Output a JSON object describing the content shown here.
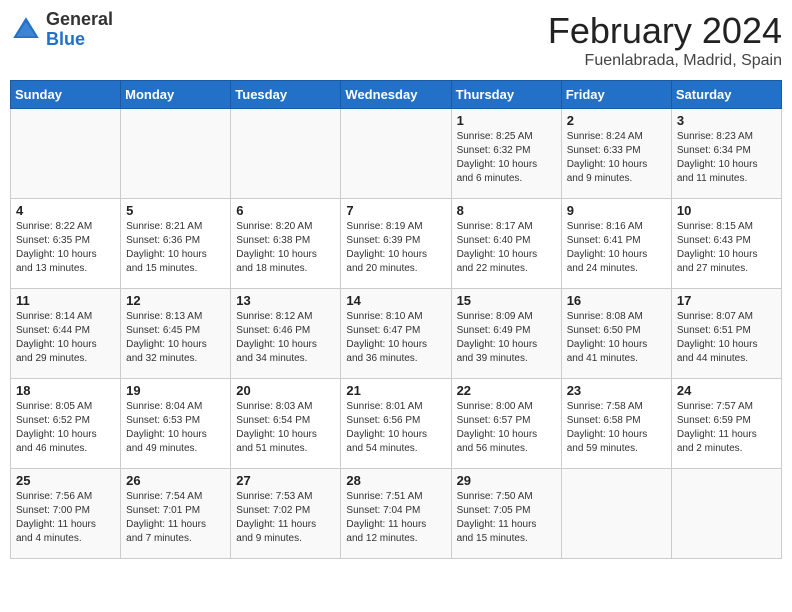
{
  "header": {
    "logo_general": "General",
    "logo_blue": "Blue",
    "title": "February 2024",
    "subtitle": "Fuenlabrada, Madrid, Spain"
  },
  "days_of_week": [
    "Sunday",
    "Monday",
    "Tuesday",
    "Wednesday",
    "Thursday",
    "Friday",
    "Saturday"
  ],
  "weeks": [
    [
      {
        "day": "",
        "info": ""
      },
      {
        "day": "",
        "info": ""
      },
      {
        "day": "",
        "info": ""
      },
      {
        "day": "",
        "info": ""
      },
      {
        "day": "1",
        "info": "Sunrise: 8:25 AM\nSunset: 6:32 PM\nDaylight: 10 hours\nand 6 minutes."
      },
      {
        "day": "2",
        "info": "Sunrise: 8:24 AM\nSunset: 6:33 PM\nDaylight: 10 hours\nand 9 minutes."
      },
      {
        "day": "3",
        "info": "Sunrise: 8:23 AM\nSunset: 6:34 PM\nDaylight: 10 hours\nand 11 minutes."
      }
    ],
    [
      {
        "day": "4",
        "info": "Sunrise: 8:22 AM\nSunset: 6:35 PM\nDaylight: 10 hours\nand 13 minutes."
      },
      {
        "day": "5",
        "info": "Sunrise: 8:21 AM\nSunset: 6:36 PM\nDaylight: 10 hours\nand 15 minutes."
      },
      {
        "day": "6",
        "info": "Sunrise: 8:20 AM\nSunset: 6:38 PM\nDaylight: 10 hours\nand 18 minutes."
      },
      {
        "day": "7",
        "info": "Sunrise: 8:19 AM\nSunset: 6:39 PM\nDaylight: 10 hours\nand 20 minutes."
      },
      {
        "day": "8",
        "info": "Sunrise: 8:17 AM\nSunset: 6:40 PM\nDaylight: 10 hours\nand 22 minutes."
      },
      {
        "day": "9",
        "info": "Sunrise: 8:16 AM\nSunset: 6:41 PM\nDaylight: 10 hours\nand 24 minutes."
      },
      {
        "day": "10",
        "info": "Sunrise: 8:15 AM\nSunset: 6:43 PM\nDaylight: 10 hours\nand 27 minutes."
      }
    ],
    [
      {
        "day": "11",
        "info": "Sunrise: 8:14 AM\nSunset: 6:44 PM\nDaylight: 10 hours\nand 29 minutes."
      },
      {
        "day": "12",
        "info": "Sunrise: 8:13 AM\nSunset: 6:45 PM\nDaylight: 10 hours\nand 32 minutes."
      },
      {
        "day": "13",
        "info": "Sunrise: 8:12 AM\nSunset: 6:46 PM\nDaylight: 10 hours\nand 34 minutes."
      },
      {
        "day": "14",
        "info": "Sunrise: 8:10 AM\nSunset: 6:47 PM\nDaylight: 10 hours\nand 36 minutes."
      },
      {
        "day": "15",
        "info": "Sunrise: 8:09 AM\nSunset: 6:49 PM\nDaylight: 10 hours\nand 39 minutes."
      },
      {
        "day": "16",
        "info": "Sunrise: 8:08 AM\nSunset: 6:50 PM\nDaylight: 10 hours\nand 41 minutes."
      },
      {
        "day": "17",
        "info": "Sunrise: 8:07 AM\nSunset: 6:51 PM\nDaylight: 10 hours\nand 44 minutes."
      }
    ],
    [
      {
        "day": "18",
        "info": "Sunrise: 8:05 AM\nSunset: 6:52 PM\nDaylight: 10 hours\nand 46 minutes."
      },
      {
        "day": "19",
        "info": "Sunrise: 8:04 AM\nSunset: 6:53 PM\nDaylight: 10 hours\nand 49 minutes."
      },
      {
        "day": "20",
        "info": "Sunrise: 8:03 AM\nSunset: 6:54 PM\nDaylight: 10 hours\nand 51 minutes."
      },
      {
        "day": "21",
        "info": "Sunrise: 8:01 AM\nSunset: 6:56 PM\nDaylight: 10 hours\nand 54 minutes."
      },
      {
        "day": "22",
        "info": "Sunrise: 8:00 AM\nSunset: 6:57 PM\nDaylight: 10 hours\nand 56 minutes."
      },
      {
        "day": "23",
        "info": "Sunrise: 7:58 AM\nSunset: 6:58 PM\nDaylight: 10 hours\nand 59 minutes."
      },
      {
        "day": "24",
        "info": "Sunrise: 7:57 AM\nSunset: 6:59 PM\nDaylight: 11 hours\nand 2 minutes."
      }
    ],
    [
      {
        "day": "25",
        "info": "Sunrise: 7:56 AM\nSunset: 7:00 PM\nDaylight: 11 hours\nand 4 minutes."
      },
      {
        "day": "26",
        "info": "Sunrise: 7:54 AM\nSunset: 7:01 PM\nDaylight: 11 hours\nand 7 minutes."
      },
      {
        "day": "27",
        "info": "Sunrise: 7:53 AM\nSunset: 7:02 PM\nDaylight: 11 hours\nand 9 minutes."
      },
      {
        "day": "28",
        "info": "Sunrise: 7:51 AM\nSunset: 7:04 PM\nDaylight: 11 hours\nand 12 minutes."
      },
      {
        "day": "29",
        "info": "Sunrise: 7:50 AM\nSunset: 7:05 PM\nDaylight: 11 hours\nand 15 minutes."
      },
      {
        "day": "",
        "info": ""
      },
      {
        "day": "",
        "info": ""
      }
    ]
  ]
}
